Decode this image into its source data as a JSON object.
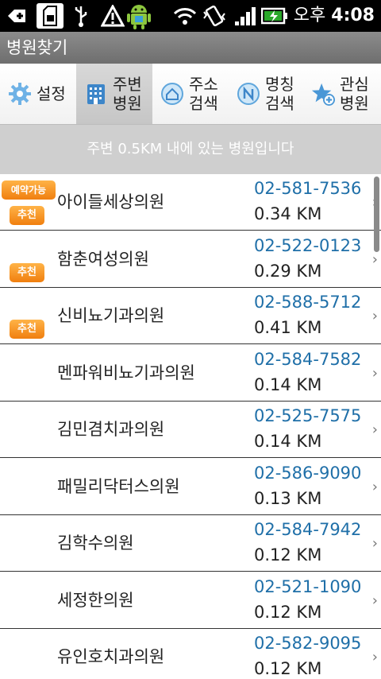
{
  "status_bar": {
    "ampm": "오후",
    "time": "4:08",
    "icons": [
      "add-icon",
      "sd-card-icon",
      "usb-icon",
      "warning-icon",
      "android-icon",
      "wifi-icon",
      "vibrate-icon",
      "signal-icon",
      "battery-icon"
    ]
  },
  "app": {
    "title": "병원찾기"
  },
  "tabs": [
    {
      "label": "설정",
      "icon": "gear-icon"
    },
    {
      "label_line1": "주변",
      "label_line2": "병원",
      "icon": "hospital-building-icon"
    },
    {
      "label_line1": "주소",
      "label_line2": "검색",
      "icon": "house-circle-icon"
    },
    {
      "label_line1": "명칭",
      "label_line2": "검색",
      "icon": "name-circle-icon"
    },
    {
      "label_line1": "관심",
      "label_line2": "병원",
      "icon": "star-plus-icon"
    }
  ],
  "notice": "주변 0.5KM 내에 있는 병원입니다",
  "badges": {
    "booking": "예약가능",
    "recommend": "추천"
  },
  "hospitals": [
    {
      "name": "아이들세상의원",
      "phone": "02-581-7536",
      "distance": "0.34 KM",
      "booking": true,
      "recommended": true
    },
    {
      "name": "함춘여성의원",
      "phone": "02-522-0123",
      "distance": "0.29 KM",
      "booking": false,
      "recommended": true
    },
    {
      "name": "신비뇨기과의원",
      "phone": "02-588-5712",
      "distance": "0.41 KM",
      "booking": false,
      "recommended": true
    },
    {
      "name": "멘파워비뇨기과의원",
      "phone": "02-584-7582",
      "distance": "0.14 KM",
      "booking": false,
      "recommended": false
    },
    {
      "name": "김민겸치과의원",
      "phone": "02-525-7575",
      "distance": "0.14 KM",
      "booking": false,
      "recommended": false
    },
    {
      "name": "패밀리닥터스의원",
      "phone": "02-586-9090",
      "distance": "0.13 KM",
      "booking": false,
      "recommended": false
    },
    {
      "name": "김학수의원",
      "phone": "02-584-7942",
      "distance": "0.12 KM",
      "booking": false,
      "recommended": false
    },
    {
      "name": "세정한의원",
      "phone": "02-521-1090",
      "distance": "0.12 KM",
      "booking": false,
      "recommended": false
    },
    {
      "name": "유인호치과의원",
      "phone": "02-582-9095",
      "distance": "0.12 KM",
      "booking": false,
      "recommended": false
    }
  ],
  "colors": {
    "phone": "#1f6fa8",
    "badge": "#f07f0f",
    "notice_bg": "#cfcfcf",
    "title_bg": "#7d7d7d"
  }
}
